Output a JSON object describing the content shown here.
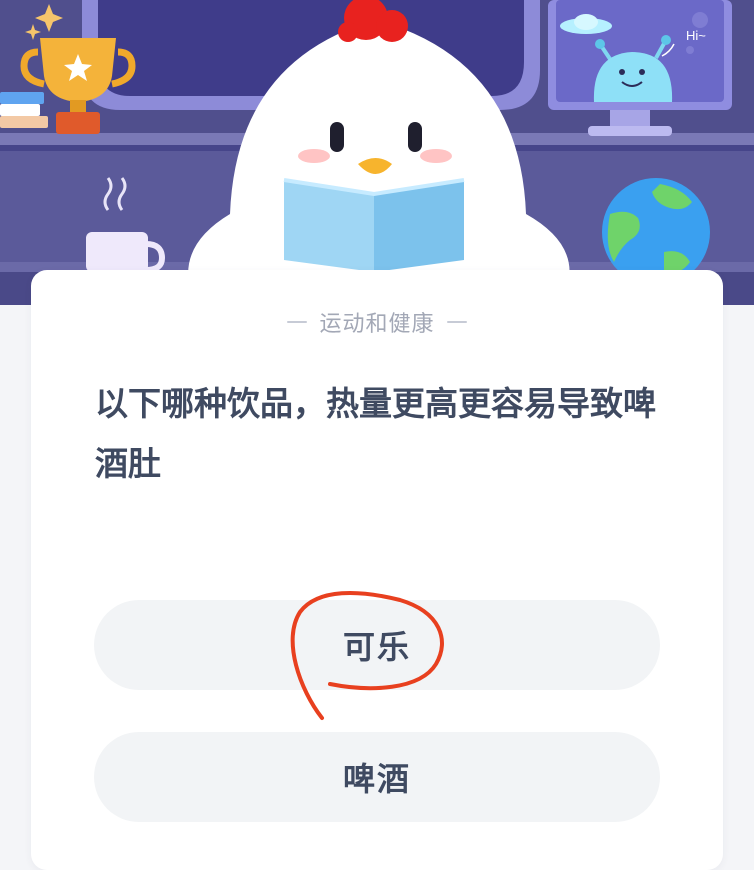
{
  "scene": {
    "monitor_greeting": "Hi~"
  },
  "quiz": {
    "category": "运动和健康",
    "question": "以下哪种饮品，热量更高更容易导致啤酒肚",
    "options": [
      {
        "label": "可乐",
        "circled": true
      },
      {
        "label": "啤酒",
        "circled": false
      }
    ]
  },
  "colors": {
    "scene_bg": "#5b5a9a",
    "card_bg": "#ffffff",
    "option_bg": "#f2f4f6",
    "text": "#3f4a61",
    "muted": "#a3a8b6",
    "annotation": "#e8401f"
  },
  "icons": [
    "trophy-icon",
    "sparkle-icon",
    "books-icon",
    "mug-icon",
    "globe-icon",
    "monitor-icon",
    "alien-icon",
    "ufo-icon",
    "chick-mascot"
  ]
}
